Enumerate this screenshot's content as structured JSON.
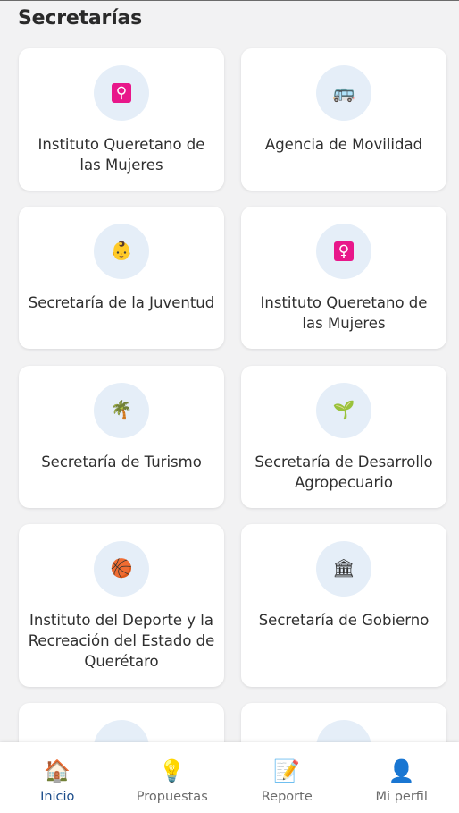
{
  "page": {
    "title": "Secretarías"
  },
  "cards": [
    {
      "label": "Instituto Queretano de las Mujeres",
      "icon": "female-sign-icon",
      "glyph": "♀"
    },
    {
      "label": "Agencia de Movilidad",
      "icon": "bus-icon",
      "glyph": "🚌"
    },
    {
      "label": "Secretaría de la Juventud",
      "icon": "baby-face-icon",
      "glyph": "👶"
    },
    {
      "label": "Instituto Queretano de las Mujeres",
      "icon": "female-sign-icon",
      "glyph": "♀"
    },
    {
      "label": "Secretaría de Turismo",
      "icon": "palm-tree-icon",
      "glyph": "🌴"
    },
    {
      "label": "Secretaría de Desarrollo Agropecuario",
      "icon": "seedling-icon",
      "glyph": "🌱"
    },
    {
      "label": "Instituto del Deporte y la Recreación del Estado de Querétaro",
      "icon": "basketball-icon",
      "glyph": "🏀"
    },
    {
      "label": "Secretaría de Gobierno",
      "icon": "classical-building-icon",
      "glyph": "🏛"
    },
    {
      "label": "",
      "icon": "partial-icon",
      "glyph": ""
    },
    {
      "label": "",
      "icon": "partial-icon",
      "glyph": ""
    }
  ],
  "nav": {
    "items": [
      {
        "label": "Inicio",
        "icon": "house-icon",
        "glyph": "🏠",
        "active": true
      },
      {
        "label": "Propuestas",
        "icon": "light-bulb-icon",
        "glyph": "💡",
        "active": false
      },
      {
        "label": "Reporte",
        "icon": "memo-pencil-icon",
        "glyph": "📝",
        "active": false
      },
      {
        "label": "Mi perfil",
        "icon": "user-silhouette-icon",
        "glyph": "👤",
        "active": false
      }
    ],
    "active_color": "#1b4c8a",
    "inactive_color": "#6b6b6b"
  },
  "colors": {
    "background": "#f2f2f3",
    "card": "#ffffff",
    "icon_circle": "#e5eef8",
    "female_icon": "#e8178a"
  }
}
